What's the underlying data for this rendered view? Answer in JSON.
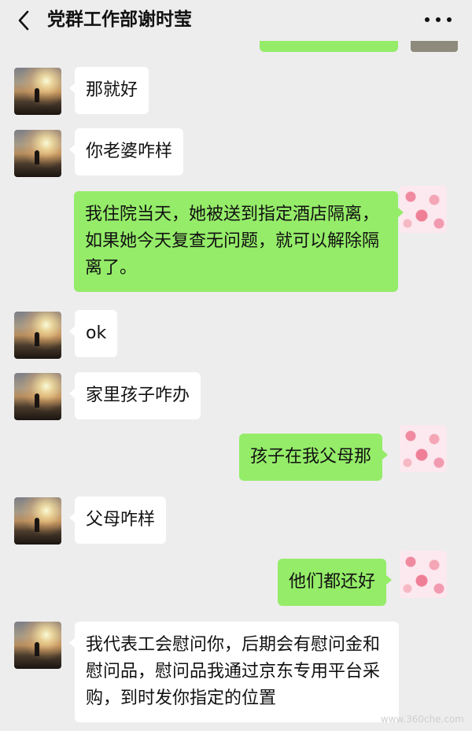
{
  "header": {
    "title": "党群工作部谢时莹",
    "back_icon": "chevron-left-icon",
    "more_icon": "more-dots-icon"
  },
  "colors": {
    "background": "#ededed",
    "incoming_bubble": "#ffffff",
    "outgoing_bubble": "#95ec69"
  },
  "messages": [
    {
      "side": "left",
      "text": "那就好"
    },
    {
      "side": "left",
      "text": "你老婆咋样"
    },
    {
      "side": "right",
      "text": "我住院当天，她被送到指定酒店隔离，如果她今天复查无问题，就可以解除隔离了。"
    },
    {
      "side": "left",
      "text": "ok"
    },
    {
      "side": "left",
      "text": "家里孩子咋办"
    },
    {
      "side": "right",
      "text": "孩子在我父母那"
    },
    {
      "side": "left",
      "text": "父母咋样"
    },
    {
      "side": "right",
      "text": "他们都还好"
    },
    {
      "side": "left",
      "text": "我代表工会慰问你，后期会有慰问金和慰问品，慰问品我通过京东专用平台采购，到时发你指定的位置"
    }
  ],
  "watermark": "www.360che.com"
}
